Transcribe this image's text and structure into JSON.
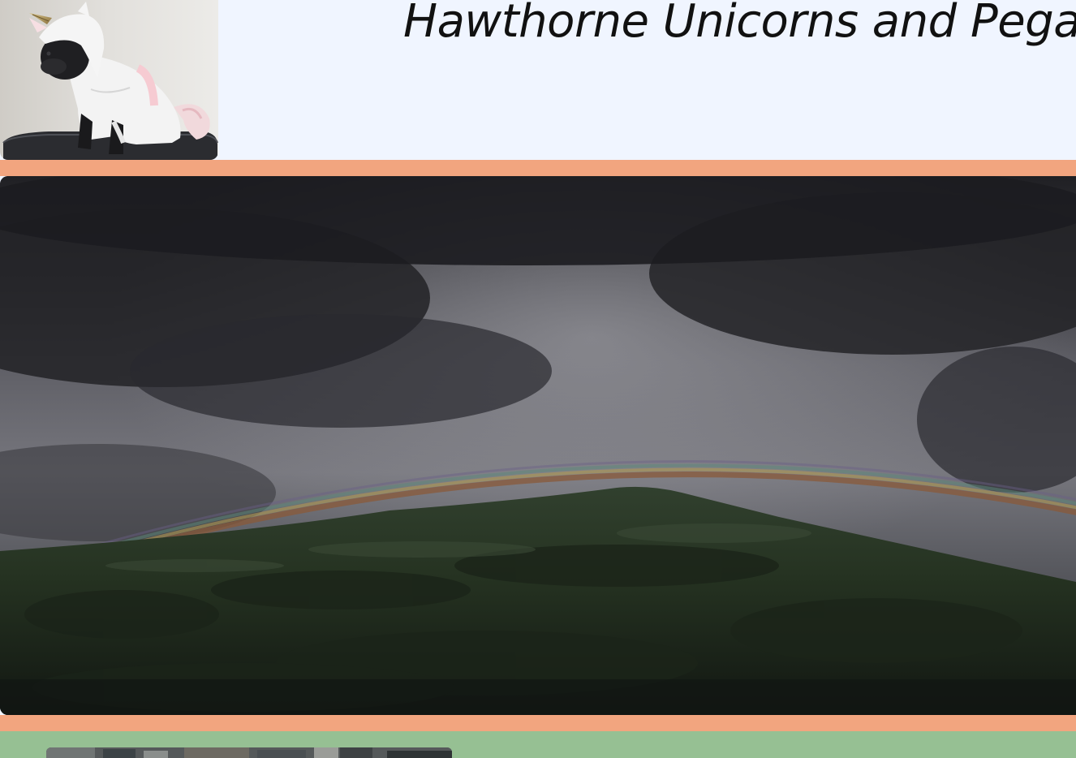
{
  "header": {
    "title": "Hawthorne Unicorns and Pegasi",
    "logo_icon": "dog-in-unicorn-costume-image"
  },
  "hero": {
    "image_icon": "rainbow-over-forested-hill-image"
  },
  "footer": {
    "thumbnail_icon": "street-scene-thumbnail-image"
  },
  "colors": {
    "header_bg": "#f0f5ff",
    "accent_band": "#f2a57f",
    "footer_bg": "#96c093"
  }
}
